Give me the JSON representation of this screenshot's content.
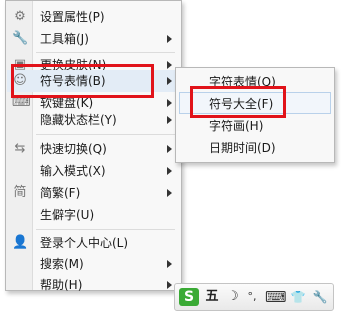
{
  "main_menu": {
    "items": [
      {
        "label": "设置属性(P)",
        "icon": "gear-icon",
        "submenu": false
      },
      {
        "label": "工具箱(J)",
        "icon": "wrench-icon",
        "submenu": true
      },
      {
        "label": "更换皮肤(N)",
        "icon": "skin-icon",
        "submenu": true
      },
      {
        "label": "符号表情(B)",
        "icon": "smiley-icon",
        "submenu": true
      },
      {
        "label": "软键盘(K)",
        "icon": "keyboard-icon",
        "submenu": true
      },
      {
        "label": "隐藏状态栏(Y)",
        "icon": "",
        "submenu": true
      },
      {
        "label": "快速切换(Q)",
        "icon": "switch-arrows-icon",
        "submenu": true
      },
      {
        "label": "输入模式(X)",
        "icon": "",
        "submenu": true
      },
      {
        "label": "简繁(F)",
        "icon": "simplified-traditional-icon",
        "submenu": true
      },
      {
        "label": "生僻字(U)",
        "icon": "",
        "submenu": false
      },
      {
        "label": "登录个人中心(L)",
        "icon": "user-icon",
        "submenu": false
      },
      {
        "label": "搜索(M)",
        "icon": "",
        "submenu": true
      },
      {
        "label": "帮助(H)",
        "icon": "",
        "submenu": true
      }
    ]
  },
  "sub_menu": {
    "items": [
      {
        "label": "字符表情(Q)"
      },
      {
        "label": "符号大全(F)"
      },
      {
        "label": "字符画(H)"
      },
      {
        "label": "日期时间(D)"
      }
    ]
  },
  "toolbar": {
    "logo_glyph": "S",
    "mode_label": "五",
    "moon_glyph": "☽",
    "punct_glyph": "°,",
    "keyboard_glyph": "⌨",
    "skin_glyph": "👕",
    "tool_glyph": "🔧"
  },
  "colors": {
    "highlight_red": "#e1131a",
    "logo_green": "#3aaa35",
    "hover_bg": "#e3ecf6"
  }
}
